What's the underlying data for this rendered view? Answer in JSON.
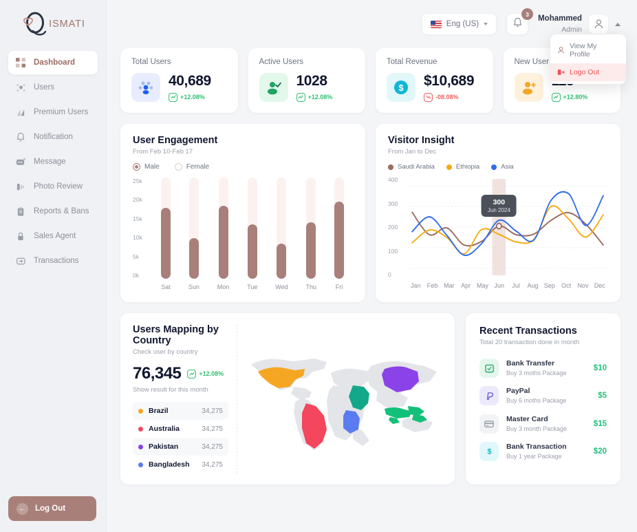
{
  "brand": {
    "name": "ISMATI",
    "logo_icon": "q-heart-logo"
  },
  "sidebar": {
    "items": [
      {
        "label": "Dashboard",
        "icon": "grid-icon",
        "active": true
      },
      {
        "label": "Users",
        "icon": "users-icon",
        "active": false
      },
      {
        "label": "Premium Users",
        "icon": "premium-icon",
        "active": false
      },
      {
        "label": "Notification",
        "icon": "bell-icon",
        "active": false
      },
      {
        "label": "Message",
        "icon": "message-icon",
        "active": false
      },
      {
        "label": "Photo Review",
        "icon": "photo-icon",
        "active": false
      },
      {
        "label": "Reports & Bans",
        "icon": "clipboard-icon",
        "active": false
      },
      {
        "label": "Sales Agent",
        "icon": "lock-icon",
        "active": false
      },
      {
        "label": "Transactions",
        "icon": "transaction-icon",
        "active": false
      }
    ],
    "logout_label": "Log Out"
  },
  "topbar": {
    "language": "Eng (US)",
    "notification_count": "3",
    "user_name": "Mohammed",
    "user_role": "Admin",
    "dropdown": [
      {
        "label": "View My Profile",
        "icon": "user-icon",
        "danger": false
      },
      {
        "label": "Logo Out",
        "icon": "logout-icon",
        "danger": true
      }
    ]
  },
  "stats": [
    {
      "title": "Total Users",
      "value": "40,689",
      "trend": "+12.08%",
      "direction": "up",
      "icon": "users-group-icon",
      "icon_bg": "#e8edfd",
      "icon_color": "#2563eb"
    },
    {
      "title": "Active Users",
      "value": "1028",
      "trend": "+12.08%",
      "direction": "up",
      "icon": "user-check-icon",
      "icon_bg": "#e2f8ea",
      "icon_color": "#22a565"
    },
    {
      "title": "Total Revenue",
      "value": "$10,689",
      "trend": "-08.08%",
      "direction": "down",
      "icon": "dollar-circle-icon",
      "icon_bg": "#e2f7fa",
      "icon_color": "#14b8d4"
    },
    {
      "title": "New User",
      "value": "113",
      "trend": "+12.80%",
      "direction": "up",
      "icon": "user-plus-icon",
      "icon_bg": "#fdf1dc",
      "icon_color": "#f5a623"
    }
  ],
  "engagement": {
    "title": "User Engagement",
    "subtitle": "From Feb 10-Feb 17",
    "options": [
      {
        "label": "Male",
        "selected": true
      },
      {
        "label": "Female",
        "selected": false
      }
    ]
  },
  "visitor": {
    "title": "Visitor Insight",
    "subtitle": "From Jan to Dec",
    "tooltip_value": "300",
    "tooltip_date": "Jun 2024",
    "legend": [
      {
        "label": "Saudi Arabia",
        "color": "#9a6b5e"
      },
      {
        "label": "Ethiopia",
        "color": "#f5ab12"
      },
      {
        "label": "Asia",
        "color": "#2f6bed"
      }
    ]
  },
  "mapping": {
    "title": "Users Mapping by Country",
    "subtitle": "Check user by country",
    "total": "76,345",
    "trend": "+12.08%",
    "note": "Show result for this month",
    "countries": [
      {
        "name": "Brazil",
        "value": "34,275",
        "color": "#f5a623"
      },
      {
        "name": "Australia",
        "value": "34,275",
        "color": "#f4465c"
      },
      {
        "name": "Pakistan",
        "value": "34,275",
        "color": "#8b42e8"
      },
      {
        "name": "Bangladesh",
        "value": "34,275",
        "color": "#5b7cf0"
      }
    ]
  },
  "transactions": {
    "title": "Recent Transactions",
    "subtitle": "Total 20 transaction done in month",
    "items": [
      {
        "name": "Bank Transfer",
        "desc": "Buy 3 moths Package",
        "amount": "$10",
        "icon": "bank-transfer-icon",
        "icon_bg": "#e4f7ec",
        "icon_color": "#22a565"
      },
      {
        "name": "PayPal",
        "desc": "Buy 6 moths Package",
        "amount": "$5",
        "icon": "paypal-icon",
        "icon_bg": "#ebe9fb",
        "icon_color": "#5b4fd6"
      },
      {
        "name": "Master Card",
        "desc": "Buy 3 month Package",
        "amount": "$15",
        "icon": "credit-card-icon",
        "icon_bg": "#f2f3f5",
        "icon_color": "#98a0ad"
      },
      {
        "name": "Bank Transaction",
        "desc": "Buy 1 year Package",
        "amount": "$20",
        "icon": "dollar-icon",
        "icon_bg": "#e2f7fa",
        "icon_color": "#14b8d4"
      }
    ]
  },
  "chart_data": [
    {
      "type": "bar",
      "title": "User Engagement",
      "subtitle": "From Feb 10-Feb 17",
      "categories": [
        "Sat",
        "Sun",
        "Mon",
        "Tue",
        "Wed",
        "Thu",
        "Fri"
      ],
      "values": [
        17500,
        10000,
        18000,
        13500,
        8700,
        14000,
        19000
      ],
      "track_max": 25000,
      "ylabel": "",
      "xlabel": "",
      "ylim": [
        0,
        25000
      ],
      "ytick_labels": [
        "25k",
        "20k",
        "15k",
        "10k",
        "5k",
        "0k"
      ],
      "ytick_values": [
        25000,
        20000,
        15000,
        10000,
        5000,
        0
      ],
      "series_name": "Male",
      "bar_color": "#a87f79",
      "track_color": "#fbf2f0",
      "grid": false,
      "legend_position": "top-left"
    },
    {
      "type": "line",
      "title": "Visitor Insight",
      "subtitle": "From Jan to Dec",
      "categories": [
        "Jan",
        "Feb",
        "Mar",
        "Apr",
        "May",
        "Jun",
        "Jul",
        "Aug",
        "Sep",
        "Oct",
        "Nov",
        "Dec"
      ],
      "ylim": [
        0,
        400
      ],
      "ytick_labels": [
        "400",
        "300",
        "200",
        "100",
        "0"
      ],
      "ytick_values": [
        400,
        300,
        200,
        100,
        0
      ],
      "grid": true,
      "legend_position": "top-left",
      "annotation": {
        "value": "300",
        "label": "Jun 2024",
        "x_category": "Jun",
        "highlight_band": "Jun"
      },
      "series": [
        {
          "name": "Saudi Arabia",
          "color": "#9a6b5e",
          "values": [
            272,
            163,
            196,
            113,
            131,
            205,
            163,
            166,
            233,
            270,
            214,
            113
          ]
        },
        {
          "name": "Ethiopia",
          "color": "#f5ab12",
          "values": [
            124,
            186,
            150,
            70,
            188,
            165,
            128,
            140,
            300,
            240,
            152,
            260
          ]
        },
        {
          "name": "Asia",
          "color": "#2f6bed",
          "values": [
            178,
            250,
            160,
            64,
            120,
            233,
            180,
            137,
            330,
            362,
            208,
            352
          ]
        }
      ]
    }
  ],
  "world_map": {
    "highlights": [
      {
        "region": "united-states",
        "color": "#f5a623"
      },
      {
        "region": "brazil",
        "color": "#f4465c"
      },
      {
        "region": "saudi-arabia",
        "color": "#14a88a"
      },
      {
        "region": "china",
        "color": "#8b42e8"
      },
      {
        "region": "dr-congo",
        "color": "#5b7cf0"
      },
      {
        "region": "indonesia",
        "color": "#13c07a"
      }
    ],
    "base_color": "#e3e5e9"
  }
}
